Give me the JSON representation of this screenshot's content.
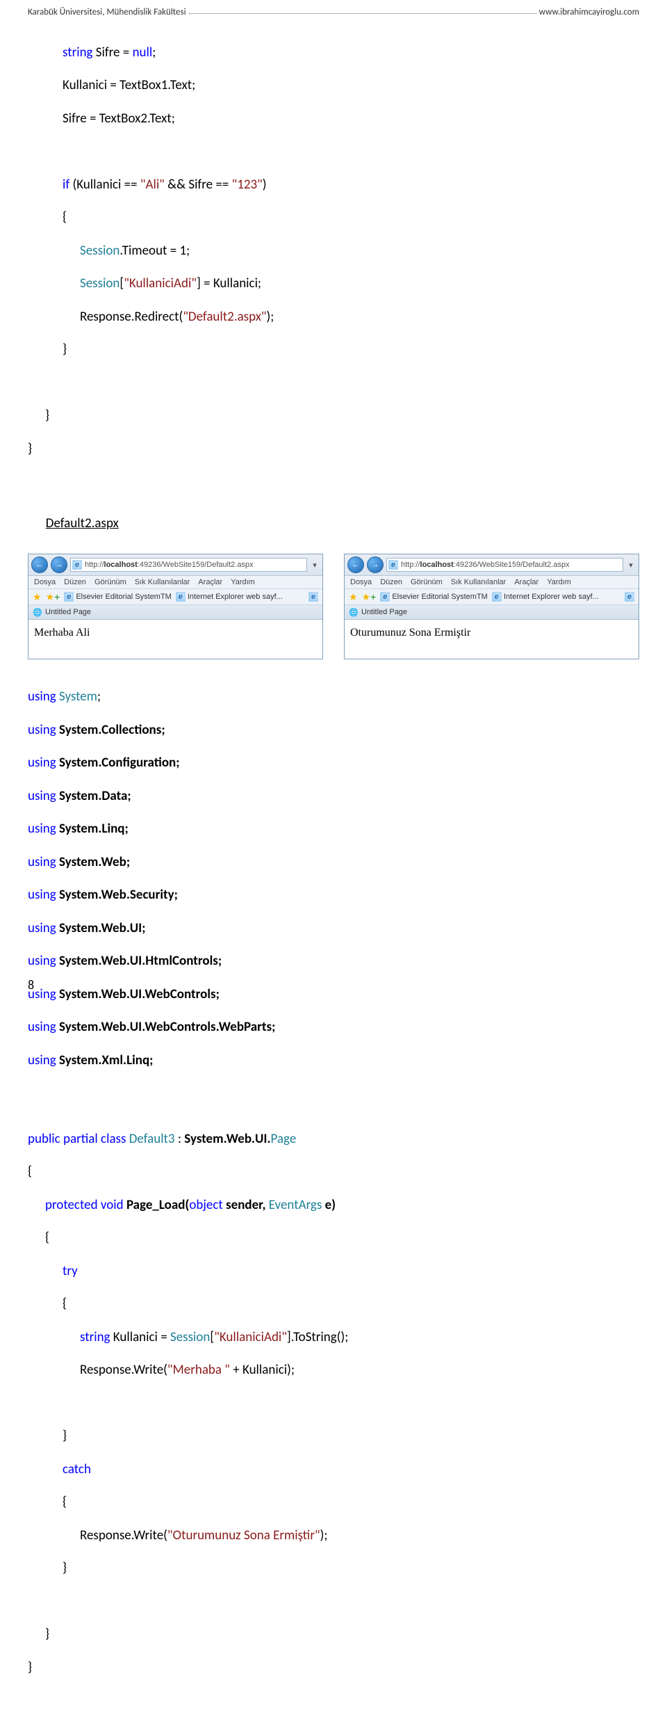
{
  "header": {
    "left": "Karabük Üniversitesi, Mühendislik Fakültesi",
    "right": "www.ibrahimcayiroglu.com"
  },
  "page_number": "8",
  "code_top": {
    "l1_a": "string",
    "l1_b": " Sifre = ",
    "l1_c": "null",
    "l1_d": ";",
    "l2": "Kullanici = TextBox1.Text;",
    "l3": "Sifre = TextBox2.Text;",
    "l4_a": "if",
    "l4_b": " (Kullanici == ",
    "l4_c": "\"Ali\"",
    "l4_d": " && Sifre == ",
    "l4_e": "\"123\"",
    "l4_f": ")",
    "l5": "{",
    "l6_a": "Session",
    "l6_b": ".Timeout = 1;",
    "l7_a": "Session",
    "l7_b": "[",
    "l7_c": "\"KullaniciAdi\"",
    "l7_d": "] = Kullanici;",
    "l8_a": "Response.Redirect(",
    "l8_b": "\"Default2.aspx\"",
    "l8_c": ");",
    "l9": "}",
    "l10": "}",
    "l11": "}"
  },
  "default2_label": "Default2.aspx",
  "browser_a": {
    "url_pre": "http://",
    "url_host": "localhost",
    "url_rest": ":49236/WebSite159/Default2.aspx",
    "menu": [
      "Dosya",
      "Düzen",
      "Görünüm",
      "Sık Kullanılanlar",
      "Araçlar",
      "Yardım"
    ],
    "fav1": "Elsevier Editorial SystemTM",
    "fav2": "Internet Explorer web sayf...",
    "tab": "Untitled Page",
    "body": "Merhaba Ali"
  },
  "browser_b": {
    "url_pre": "http://",
    "url_host": "localhost",
    "url_rest": ":49236/WebSite159/Default2.aspx",
    "menu": [
      "Dosya",
      "Düzen",
      "Görünüm",
      "Sık Kullanılanlar",
      "Araçlar",
      "Yardım"
    ],
    "fav1": "Elsevier Editorial SystemTM",
    "fav2": "Internet Explorer web sayf...",
    "tab": "Untitled Page",
    "body": "Oturumunuz Sona Ermiştir"
  },
  "using_lines": {
    "u1_a": "using ",
    "u1_b": "System",
    "u1_c": ";",
    "u2": "using System.Collections;",
    "u3": "using System.Configuration;",
    "u4": "using System.Data;",
    "u5": "using System.Linq;",
    "u6": "using System.Web;",
    "u7": "using System.Web.Security;",
    "u8": "using System.Web.UI;",
    "u9": "using System.Web.UI.HtmlControls;",
    "u10": "using System.Web.UI.WebControls;",
    "u11": "using System.Web.UI.WebControls.WebParts;",
    "u12": "using System.Xml.Linq;"
  },
  "class_block": {
    "c1_a": "public partial class ",
    "c1_b": "Default3",
    "c1_c": " : ",
    "c1_d": "System.Web.UI.",
    "c1_e": "Page",
    "c2": "{",
    "c3_a": "protected void ",
    "c3_b": "Page_Load(",
    "c3_c": "object ",
    "c3_d": "sender, ",
    "c3_e": "EventArgs ",
    "c3_f": "e)",
    "c4": "{",
    "c5": "try",
    "c6": "{",
    "c7_a": "string",
    "c7_b": " Kullanici = ",
    "c7_c": "Session",
    "c7_d": "[",
    "c7_e": "\"KullaniciAdi\"",
    "c7_f": "].ToString();",
    "c8_a": "Response.Write(",
    "c8_b": "\"Merhaba \"",
    "c8_c": " + Kullanici);",
    "c9": "}",
    "c10": "catch",
    "c11": "{",
    "c12_a": "Response.Write(",
    "c12_b": "\"Oturumunuz Sona Ermiştir\"",
    "c12_c": ");",
    "c13": "}",
    "c14": "}",
    "c15": "}"
  }
}
